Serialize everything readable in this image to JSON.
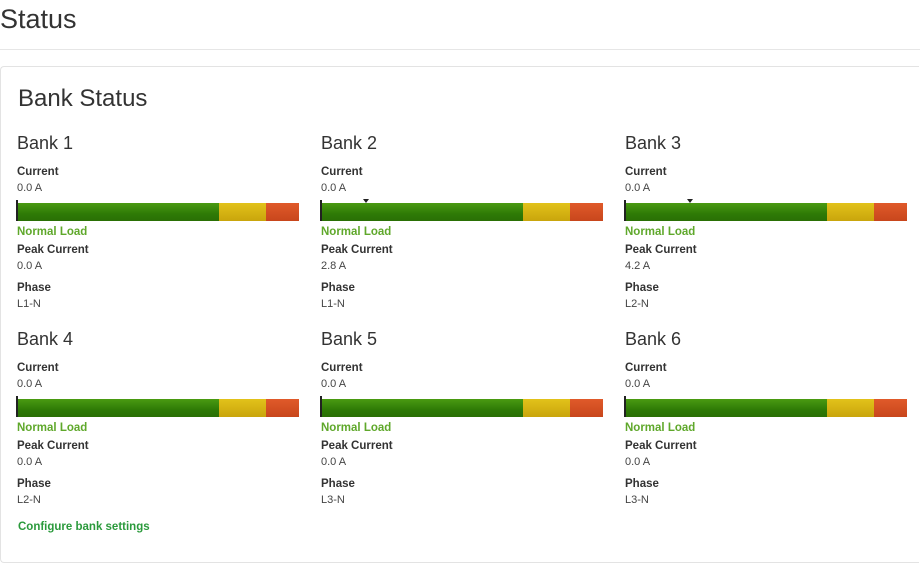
{
  "page": {
    "title": "Status"
  },
  "panel": {
    "title": "Bank Status"
  },
  "labels": {
    "current": "Current",
    "peak_current": "Peak Current",
    "phase": "Phase"
  },
  "gauge_colors": {
    "normal": "#3a8a0a",
    "warning": "#d4b414",
    "critical": "#d45020",
    "status_text": "#5fa82b"
  },
  "banks": [
    {
      "name": "Bank 1",
      "current": "0.0 A",
      "load_status": "Normal Load",
      "peak_current": "0.0 A",
      "phase": "L1-N",
      "peak_marker_fraction": 0
    },
    {
      "name": "Bank 2",
      "current": "0.0 A",
      "load_status": "Normal Load",
      "peak_current": "2.8 A",
      "phase": "L1-N",
      "peak_marker_fraction": 0.16
    },
    {
      "name": "Bank 3",
      "current": "0.0 A",
      "load_status": "Normal Load",
      "peak_current": "4.2 A",
      "phase": "L2-N",
      "peak_marker_fraction": 0.23
    },
    {
      "name": "Bank 4",
      "current": "0.0 A",
      "load_status": "Normal Load",
      "peak_current": "0.0 A",
      "phase": "L2-N",
      "peak_marker_fraction": 0
    },
    {
      "name": "Bank 5",
      "current": "0.0 A",
      "load_status": "Normal Load",
      "peak_current": "0.0 A",
      "phase": "L3-N",
      "peak_marker_fraction": 0
    },
    {
      "name": "Bank 6",
      "current": "0.0 A",
      "load_status": "Normal Load",
      "peak_current": "0.0 A",
      "phase": "L3-N",
      "peak_marker_fraction": 0
    }
  ],
  "configure_link": "Configure bank settings"
}
